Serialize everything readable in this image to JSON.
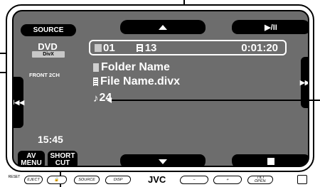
{
  "controls": {
    "source_label": "SOURCE",
    "play_pause_label": "▶/II",
    "prev_label": "I◀◀",
    "next_label": "▶▶I",
    "av_menu_line1": "AV",
    "av_menu_line2": "MENU",
    "short_cut_line1": "SHORT",
    "short_cut_line2": "CUT"
  },
  "source": {
    "name": "DVD",
    "format": "DivX",
    "audio_mode": "FRONT 2CH"
  },
  "status": {
    "folder_number": "01",
    "file_number": "13",
    "elapsed_time": "0:01:20"
  },
  "track": {
    "folder_name": "Folder Name",
    "file_name": "File Name.divx",
    "track_number": "24"
  },
  "clock": "15:45",
  "panel": {
    "reset_label": "RESET",
    "eject_label": "EJECT",
    "source_label": "SOURCE",
    "disp_label": "DISP",
    "brand": "JVC",
    "minus_label": "−",
    "plus_label": "+",
    "tilt_label": "TILT",
    "open_label": "OPEN"
  }
}
